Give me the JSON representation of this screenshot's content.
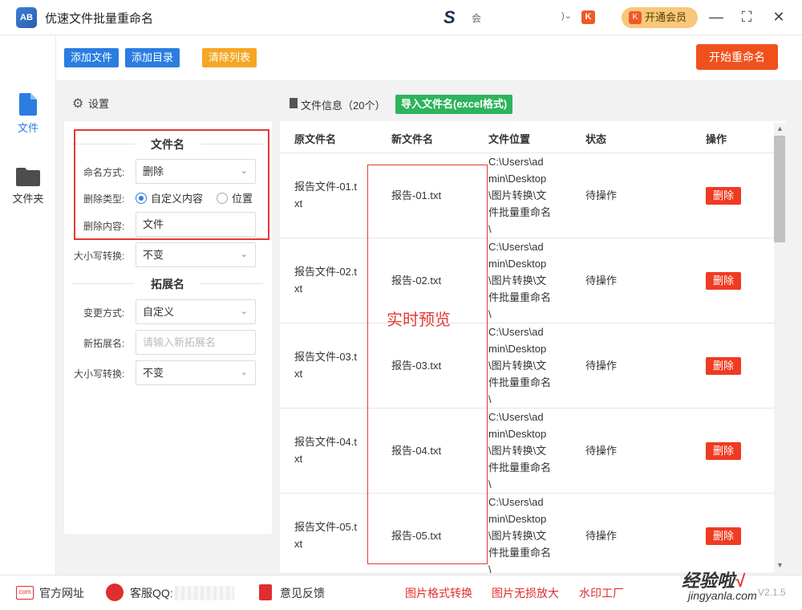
{
  "app": {
    "title": "优速文件批量重命名",
    "logo_text": "AB",
    "user_logo_char": "S",
    "user_name": "会",
    "user_caret": ")⌄",
    "brand_badge": "K",
    "vip_label": "开通会员",
    "vip_icon": "K"
  },
  "window_controls": {
    "minimize": "—",
    "maximize": "⛶",
    "close": "✕"
  },
  "nav": {
    "items": [
      {
        "label": "文件",
        "icon": "file-icon",
        "active": true,
        "color": "#2a7de1"
      },
      {
        "label": "文件夹",
        "icon": "folder-icon",
        "active": false,
        "color": "#4d4d4d"
      }
    ]
  },
  "toolbar": {
    "add_file": "添加文件",
    "add_dir": "添加目录",
    "clear_list": "清除列表",
    "start_rename": "开始重命名"
  },
  "settings": {
    "header": "设置",
    "filename_section": "文件名",
    "naming_method_label": "命名方式:",
    "naming_method_value": "删除",
    "delete_type_label": "删除类型:",
    "delete_type_options": [
      "自定义内容",
      "位置"
    ],
    "delete_type_selected": "自定义内容",
    "delete_content_label": "删除内容:",
    "delete_content_value": "文件",
    "case_label": "大小写转换:",
    "case_value": "不变",
    "ext_section": "拓展名",
    "change_method_label": "变更方式:",
    "change_method_value": "自定义",
    "new_ext_label": "新拓展名:",
    "new_ext_placeholder": "请输入新拓展名",
    "ext_case_label": "大小写转换:",
    "ext_case_value": "不变"
  },
  "files": {
    "title": "文件信息（20个）",
    "import_btn": "导入文件名(excel格式)",
    "columns": [
      "原文件名",
      "新文件名",
      "文件位置",
      "状态",
      "操作"
    ],
    "rows": [
      {
        "orig": [
          "报告文件-01.t",
          "xt"
        ],
        "new": "报告-01.txt",
        "path": [
          "C:\\Users\\ad",
          "min\\Desktop",
          "\\图片转换\\文",
          "件批量重命名",
          "\\"
        ],
        "status": "待操作",
        "action": "删除"
      },
      {
        "orig": [
          "报告文件-02.t",
          "xt"
        ],
        "new": "报告-02.txt",
        "path": [
          "C:\\Users\\ad",
          "min\\Desktop",
          "\\图片转换\\文",
          "件批量重命名",
          "\\"
        ],
        "status": "待操作",
        "action": "删除"
      },
      {
        "orig": [
          "报告文件-03.t",
          "xt"
        ],
        "new": "报告-03.txt",
        "path": [
          "C:\\Users\\ad",
          "min\\Desktop",
          "\\图片转换\\文",
          "件批量重命名",
          "\\"
        ],
        "status": "待操作",
        "action": "删除"
      },
      {
        "orig": [
          "报告文件-04.t",
          "xt"
        ],
        "new": "报告-04.txt",
        "path": [
          "C:\\Users\\ad",
          "min\\Desktop",
          "\\图片转换\\文",
          "件批量重命名",
          "\\"
        ],
        "status": "待操作",
        "action": "删除"
      },
      {
        "orig": [
          "报告文件-05.t",
          "xt"
        ],
        "new": "报告-05.txt",
        "path": [
          "C:\\Users\\ad",
          "min\\Desktop",
          "\\图片转换\\文",
          "件批量重命名",
          "\\"
        ],
        "status": "待操作",
        "action": "删除"
      }
    ],
    "preview_annotation": "实时预览"
  },
  "footer": {
    "website": "官方网址",
    "website_icon": "com",
    "qq_label": "客服QQ:",
    "feedback": "意见反馈",
    "img_convert": "图片格式转换",
    "img_enlarge": "图片无损放大",
    "watermark_factory": "水印工厂",
    "version": "V2.1.5"
  },
  "watermark": {
    "main": "经验啦",
    "check": "√",
    "sub": "jingyanla.com"
  },
  "colors": {
    "blue": "#2a7de1",
    "orange": "#f5a623",
    "red": "#f0511c",
    "green": "#2db45c",
    "annotation_red": "#e53935"
  }
}
